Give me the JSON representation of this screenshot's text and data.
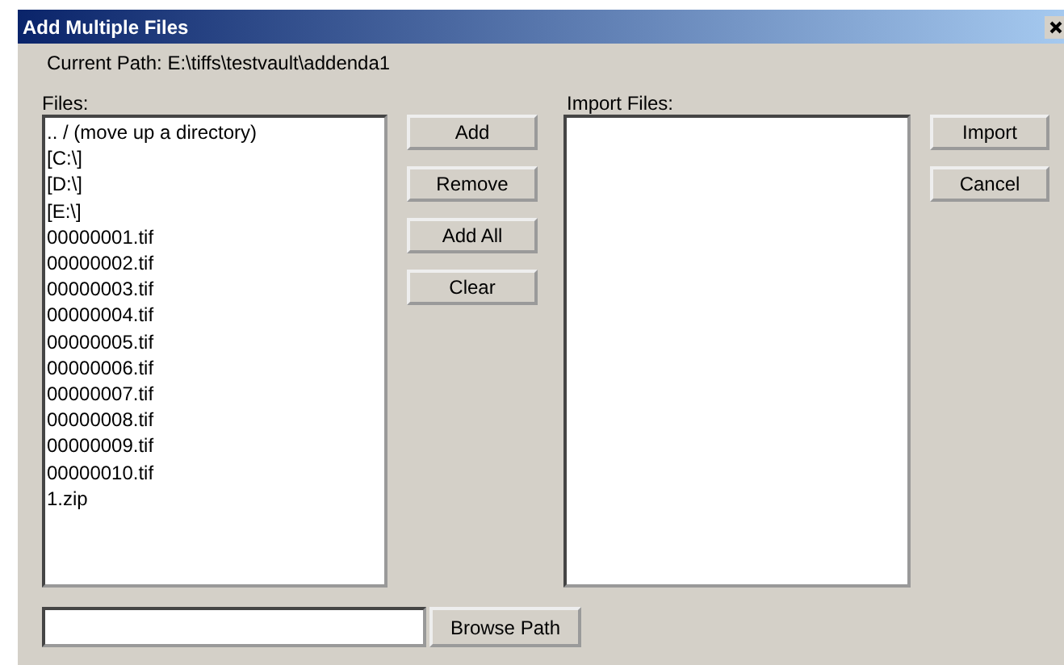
{
  "window": {
    "title": "Add Multiple Files"
  },
  "current_path": "Current Path: E:\\tiffs\\testvault\\addenda1",
  "files": {
    "label": "Files:",
    "items": [
      {
        "name": ".. / (move up a directory)"
      },
      {
        "name": "[C:\\]"
      },
      {
        "name": "[D:\\]"
      },
      {
        "name": "[E:\\]"
      },
      {
        "name": "00000001.tif"
      },
      {
        "name": "00000002.tif"
      },
      {
        "name": "00000003.tif"
      },
      {
        "name": "00000004.tif"
      },
      {
        "name": "00000005.tif"
      },
      {
        "name": "00000006.tif"
      },
      {
        "name": "00000007.tif"
      },
      {
        "name": "00000008.tif"
      },
      {
        "name": "00000009.tif"
      },
      {
        "name": "00000010.tif"
      },
      {
        "name": "1.zip"
      }
    ]
  },
  "middle_buttons": [
    "Add",
    "Remove",
    "Add All",
    "Clear"
  ],
  "import_files": {
    "label": "Import Files:"
  },
  "side_buttons": [
    "Import",
    "Cancel"
  ],
  "browse_button": "Browse Path"
}
